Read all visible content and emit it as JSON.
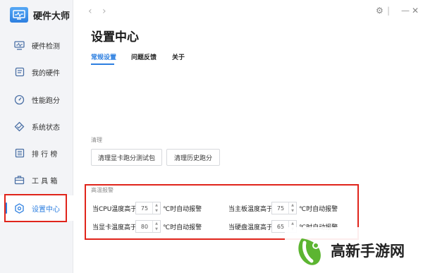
{
  "app": {
    "name": "硬件大师"
  },
  "sidebar": {
    "items": [
      {
        "label": "硬件检测",
        "icon": "monitor-icon"
      },
      {
        "label": "我的硬件",
        "icon": "card-icon"
      },
      {
        "label": "性能跑分",
        "icon": "gauge-icon"
      },
      {
        "label": "系统状态",
        "icon": "diamond-icon"
      },
      {
        "label": "排 行 榜",
        "icon": "list-icon"
      },
      {
        "label": "工 具 箱",
        "icon": "toolbox-icon"
      },
      {
        "label": "设置中心",
        "icon": "settings-icon",
        "active": true
      }
    ]
  },
  "topbar": {
    "back": "‹",
    "forward": "›",
    "settings": "⚙",
    "divider": "|",
    "close": "✕"
  },
  "page": {
    "title": "设置中心"
  },
  "tabs": [
    {
      "label": "常规设置",
      "active": true
    },
    {
      "label": "问题反馈"
    },
    {
      "label": "关于"
    }
  ],
  "clean": {
    "label": "清理",
    "buttons": [
      "清理显卡跑分测试包",
      "清理历史跑分"
    ]
  },
  "alarm": {
    "label": "高温报警",
    "items": [
      {
        "label": "当CPU温度高于",
        "value": "75",
        "suffix": "℃时自动报警"
      },
      {
        "label": "当主板温度高于",
        "value": "75",
        "suffix": "℃时自动报警"
      },
      {
        "label": "当显卡温度高于",
        "value": "80",
        "suffix": "℃时自动报警"
      },
      {
        "label": "当硬盘温度高于",
        "value": "65",
        "suffix": "℃时自动报警"
      }
    ]
  },
  "watermark": {
    "text": "高新手游网"
  },
  "colors": {
    "accent": "#2d7fe0",
    "highlight": "#e0241b",
    "watermark_green": "#5cb531"
  }
}
